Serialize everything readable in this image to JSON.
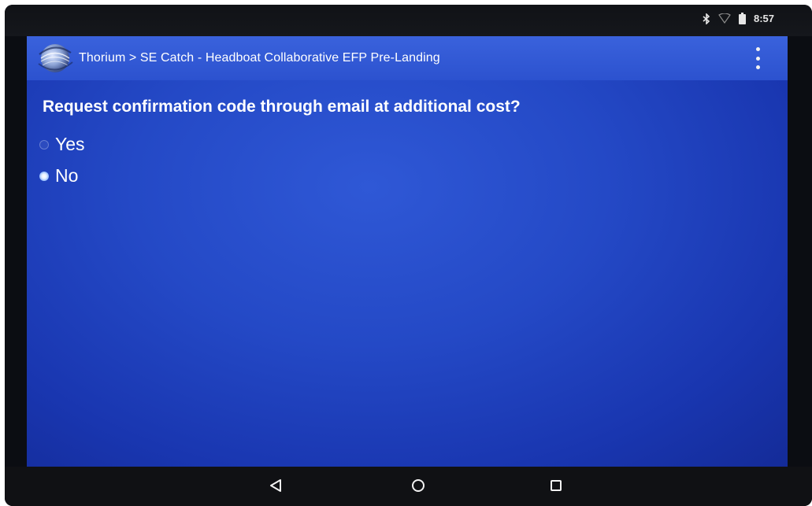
{
  "status_bar": {
    "time": "8:57",
    "icons": [
      "bluetooth-icon",
      "wifi-icon",
      "battery-icon"
    ]
  },
  "app_bar": {
    "logo_icon": "globe-logo-icon",
    "title": "Thorium > SE Catch - Headboat Collaborative EFP Pre-Landing",
    "menu_icon": "overflow-menu-icon"
  },
  "form": {
    "question": "Request confirmation code through email at additional cost?",
    "options": [
      {
        "label": "Yes",
        "selected": false
      },
      {
        "label": "No",
        "selected": true
      }
    ]
  },
  "nav_bar": {
    "icons": [
      "back-icon",
      "home-icon",
      "recents-icon"
    ]
  },
  "colors": {
    "screen_blue": "#2449c6",
    "app_bar_blue": "#3a62dc",
    "radio_selected": "#8fb8ff",
    "text": "#ffffff"
  }
}
